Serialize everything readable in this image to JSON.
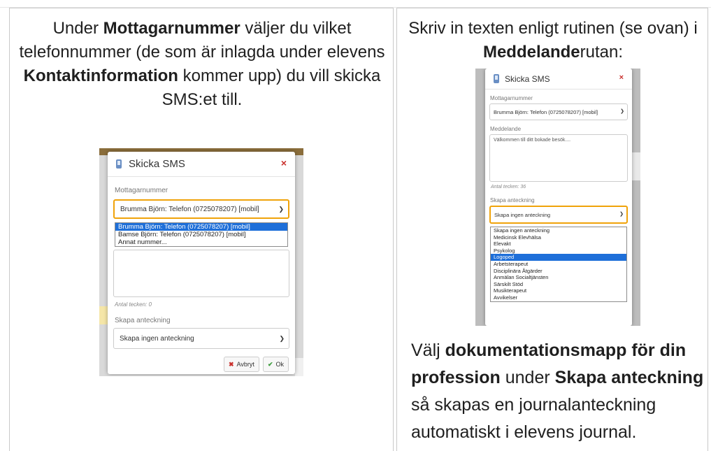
{
  "left": {
    "instruction": {
      "p1": "Under ",
      "b1": "Mottagarnummer",
      "p2": " väljer du vilket telefonnummer (de som är inlagda under elevens ",
      "b2": "Kontaktinformation",
      "p3": " kommer upp) du vill skicka SMS:et till."
    },
    "modal": {
      "title": "Skicka SMS",
      "close_icon": "×",
      "recipient_label": "Mottagarnummer",
      "recipient_value": "Brumma Björn: Telefon (0725078207) [mobil]",
      "options": [
        "Brumma Björn: Telefon (0725078207) [mobil]",
        "Bamse Björn: Telefon (0725078207) [mobil]",
        "Annat nummer..."
      ],
      "char_count": "Antal tecken: 0",
      "note_label": "Skapa anteckning",
      "note_value": "Skapa ingen anteckning",
      "cancel_label": "Avbryt",
      "ok_label": "Ok"
    }
  },
  "right": {
    "instruction_top": {
      "p1": "Skriv in texten enligt rutinen (se ovan) i ",
      "b1": "Meddelande",
      "p2": "rutan:"
    },
    "modal": {
      "title": "Skicka SMS",
      "close_icon": "×",
      "recipient_label": "Mottagarnummer",
      "recipient_value": "Brumma Björn: Telefon (0725078207) [mobil]",
      "message_label": "Meddelande",
      "message_value": "Välkommen till ditt bokade besök....",
      "char_count": "Antal tecken: 36",
      "note_label": "Skapa anteckning",
      "note_value": "Skapa ingen anteckning",
      "options": [
        "Skapa ingen anteckning",
        "Medicinsk Elevhälsa",
        "Elevakt",
        "Psykolog",
        "Logoped",
        "Arbetsterapeut",
        "Disciplinära Åtgärder",
        "Anmälan Socialtjänsten",
        "Särskilt Stöd",
        "Musikterapeut",
        "Avvikelser"
      ]
    },
    "instruction_bottom": {
      "p1": "Välj ",
      "b1": "dokumentationsmapp för din profession",
      "p2": " under ",
      "b2": "Skapa anteckning",
      "p3": " så skapas en journalanteckning automatiskt i elevens journal."
    }
  },
  "colors": {
    "accent_focus": "#f0a30a",
    "selected_option": "#1e6fd9",
    "close_red": "#c9302c",
    "ok_green": "#3d9c3d"
  }
}
